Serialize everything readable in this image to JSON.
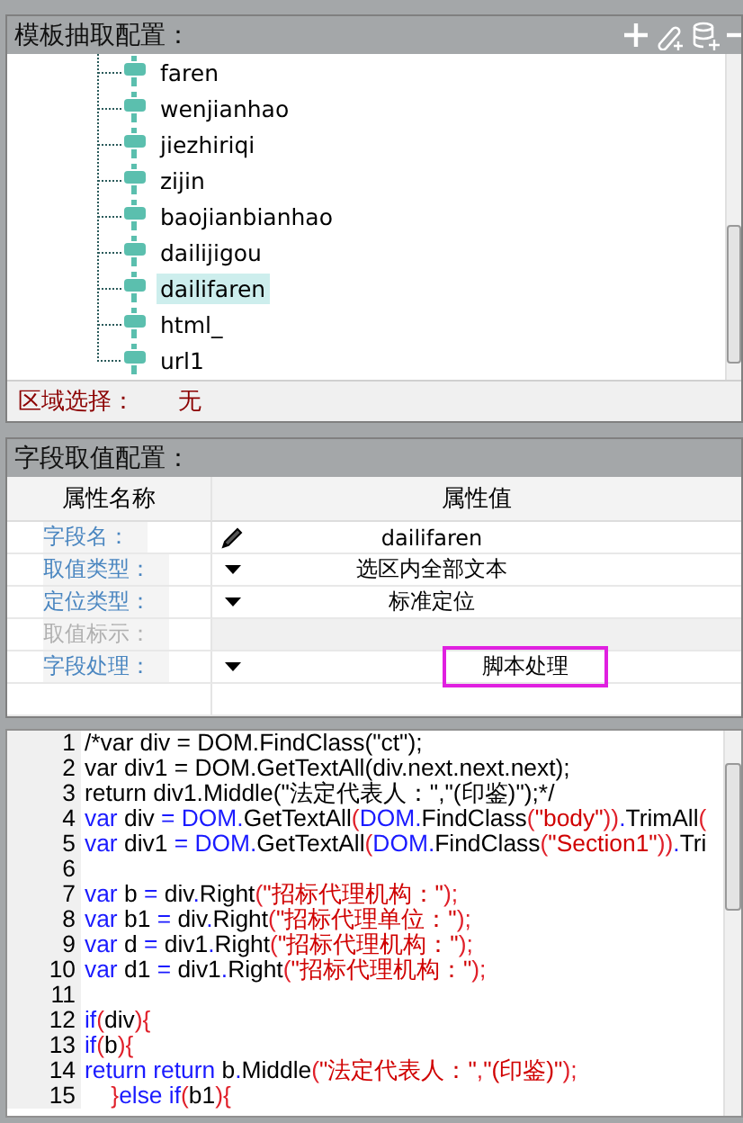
{
  "template_panel": {
    "title": "模板抽取配置：",
    "tree_items": [
      {
        "label": "faren",
        "selected": false
      },
      {
        "label": "wenjianhao",
        "selected": false
      },
      {
        "label": "jiezhiriqi",
        "selected": false
      },
      {
        "label": "zijin",
        "selected": false
      },
      {
        "label": "baojianbianhao",
        "selected": false
      },
      {
        "label": "dailijigou",
        "selected": false
      },
      {
        "label": "dailifaren",
        "selected": true
      },
      {
        "label": "html_",
        "selected": false
      },
      {
        "label": "url1",
        "selected": false
      }
    ],
    "region_label": "区域选择：",
    "region_value": "无"
  },
  "field_panel": {
    "title": "字段取值配置：",
    "columns": [
      "属性名称",
      "属性值"
    ],
    "rows": [
      {
        "name": "字段名：",
        "kind": "edit",
        "value": "dailifaren",
        "disabled": false
      },
      {
        "name": "取值类型：",
        "kind": "dropdown",
        "value": "选区内全部文本",
        "disabled": false
      },
      {
        "name": "定位类型：",
        "kind": "dropdown",
        "value": "标准定位",
        "disabled": false
      },
      {
        "name": "取值标示：",
        "kind": "blank",
        "disabled": true
      },
      {
        "name": "字段处理：",
        "kind": "dropdown",
        "value": "脚本处理",
        "disabled": false,
        "highlighted": true
      }
    ]
  },
  "code_editor": {
    "lines": [
      {
        "number": "1",
        "segments": [
          {
            "kind": "t",
            "text": "/*var div = DOM.FindClass(\"ct\");"
          }
        ]
      },
      {
        "number": "2",
        "segments": [
          {
            "kind": "t",
            "text": "var div1 = DOM.GetTextAll(div.next.next.next);"
          }
        ]
      },
      {
        "number": "3",
        "segments": [
          {
            "kind": "t",
            "text": "return div1.Middle(\"法定代表人：\",\"(印鉴)\");*/"
          }
        ]
      },
      {
        "number": "4",
        "segments": [
          {
            "kind": "k",
            "text": "var"
          },
          {
            "kind": "t",
            "text": " div "
          },
          {
            "kind": "k",
            "text": "= DOM."
          },
          {
            "kind": "t",
            "text": "GetTextAll"
          },
          {
            "kind": "p",
            "text": "("
          },
          {
            "kind": "k",
            "text": "DOM."
          },
          {
            "kind": "t",
            "text": "FindClass"
          },
          {
            "kind": "p",
            "text": "("
          },
          {
            "kind": "s",
            "text": "\"body\""
          },
          {
            "kind": "p",
            "text": "))"
          },
          {
            "kind": "k",
            "text": "."
          },
          {
            "kind": "t",
            "text": "TrimAll"
          },
          {
            "kind": "p",
            "text": "("
          }
        ]
      },
      {
        "number": "5",
        "segments": [
          {
            "kind": "k",
            "text": "var"
          },
          {
            "kind": "t",
            "text": " div1 "
          },
          {
            "kind": "k",
            "text": "= DOM."
          },
          {
            "kind": "t",
            "text": "GetTextAll"
          },
          {
            "kind": "p",
            "text": "("
          },
          {
            "kind": "k",
            "text": "DOM."
          },
          {
            "kind": "t",
            "text": "FindClass"
          },
          {
            "kind": "p",
            "text": "("
          },
          {
            "kind": "s",
            "text": "\"Section1\""
          },
          {
            "kind": "p",
            "text": "))"
          },
          {
            "kind": "k",
            "text": "."
          },
          {
            "kind": "t",
            "text": "Tri"
          }
        ]
      },
      {
        "number": "6"
      },
      {
        "number": "7",
        "segments": [
          {
            "kind": "k",
            "text": "var"
          },
          {
            "kind": "t",
            "text": " b "
          },
          {
            "kind": "k",
            "text": "="
          },
          {
            "kind": "t",
            "text": " div"
          },
          {
            "kind": "k",
            "text": "."
          },
          {
            "kind": "t",
            "text": "Right"
          },
          {
            "kind": "p",
            "text": "("
          },
          {
            "kind": "s",
            "text": "\"招标代理机构：\""
          },
          {
            "kind": "p",
            "text": ");"
          }
        ]
      },
      {
        "number": "8",
        "segments": [
          {
            "kind": "k",
            "text": "var"
          },
          {
            "kind": "t",
            "text": " b1 "
          },
          {
            "kind": "k",
            "text": "="
          },
          {
            "kind": "t",
            "text": " div"
          },
          {
            "kind": "k",
            "text": "."
          },
          {
            "kind": "t",
            "text": "Right"
          },
          {
            "kind": "p",
            "text": "("
          },
          {
            "kind": "s",
            "text": "\"招标代理单位：\""
          },
          {
            "kind": "p",
            "text": ");"
          }
        ]
      },
      {
        "number": "9",
        "segments": [
          {
            "kind": "k",
            "text": "var"
          },
          {
            "kind": "t",
            "text": " d "
          },
          {
            "kind": "k",
            "text": "="
          },
          {
            "kind": "t",
            "text": " div1"
          },
          {
            "kind": "k",
            "text": "."
          },
          {
            "kind": "t",
            "text": "Right"
          },
          {
            "kind": "p",
            "text": "("
          },
          {
            "kind": "s",
            "text": "\"招标代理机构：\""
          },
          {
            "kind": "p",
            "text": ");"
          }
        ]
      },
      {
        "number": "10",
        "segments": [
          {
            "kind": "k",
            "text": "var"
          },
          {
            "kind": "t",
            "text": " d1 "
          },
          {
            "kind": "k",
            "text": "="
          },
          {
            "kind": "t",
            "text": " div1"
          },
          {
            "kind": "k",
            "text": "."
          },
          {
            "kind": "t",
            "text": "Right"
          },
          {
            "kind": "p",
            "text": "("
          },
          {
            "kind": "s",
            "text": "\"招标代理机构：\""
          },
          {
            "kind": "p",
            "text": ");"
          }
        ]
      },
      {
        "number": "11"
      },
      {
        "number": "12",
        "segments": [
          {
            "kind": "k",
            "text": "if"
          },
          {
            "kind": "p",
            "text": "("
          },
          {
            "kind": "t",
            "text": "div"
          },
          {
            "kind": "p",
            "text": "){"
          }
        ]
      },
      {
        "number": "13",
        "segments": [
          {
            "kind": "k",
            "text": "if"
          },
          {
            "kind": "p",
            "text": "("
          },
          {
            "kind": "t",
            "text": "b"
          },
          {
            "kind": "p",
            "text": "){"
          }
        ]
      },
      {
        "number": "14",
        "segments": [
          {
            "kind": "k",
            "text": "return return"
          },
          {
            "kind": "t",
            "text": " b"
          },
          {
            "kind": "k",
            "text": "."
          },
          {
            "kind": "t",
            "text": "Middle"
          },
          {
            "kind": "p",
            "text": "("
          },
          {
            "kind": "s",
            "text": "\"法定代表人：\""
          },
          {
            "kind": "p",
            "text": ","
          },
          {
            "kind": "s",
            "text": "\"(印鉴)\""
          },
          {
            "kind": "p",
            "text": ");"
          }
        ]
      },
      {
        "number": "15",
        "segments": [
          {
            "kind": "p",
            "text": "    }"
          },
          {
            "kind": "k",
            "text": "else if"
          },
          {
            "kind": "p",
            "text": "("
          },
          {
            "kind": "t",
            "text": "b1"
          },
          {
            "kind": "p",
            "text": "){"
          }
        ]
      }
    ]
  }
}
